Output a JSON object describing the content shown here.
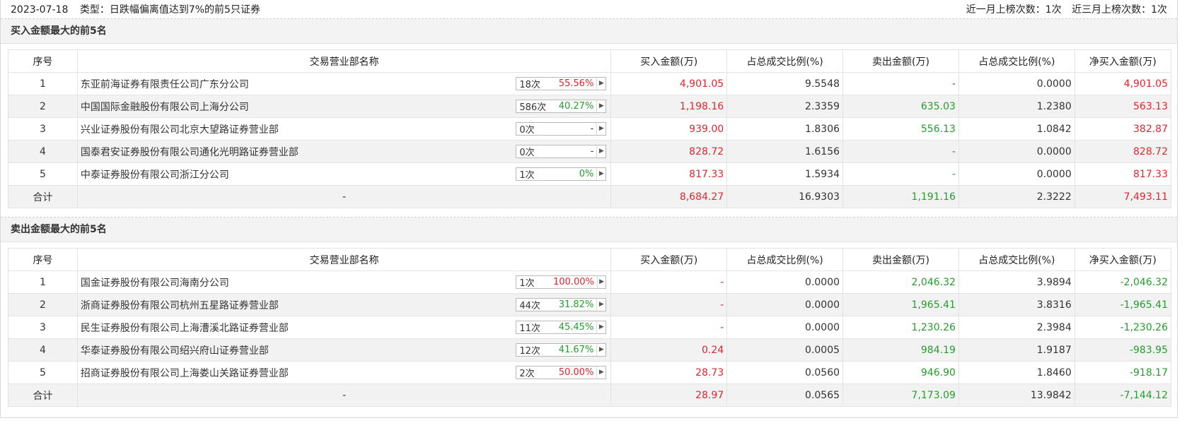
{
  "header": {
    "date": "2023-07-18",
    "type_label": "类型：日跌幅偏离值达到7%的前5只证券",
    "month_count": "近一月上榜次数：1次",
    "three_month_count": "近三月上榜次数：1次"
  },
  "columns": [
    "序号",
    "交易营业部名称",
    "买入金额(万)",
    "占总成交比例(%)",
    "卖出金额(万)",
    "占总成交比例(%)",
    "净买入金额(万)"
  ],
  "buy_section": {
    "title": "买入金额最大的前5名",
    "rows": [
      {
        "idx": "1",
        "name": "东亚前海证券有限责任公司广东分公司",
        "times": "18次",
        "rate": "55.56%",
        "rate_color": "red",
        "buy": "4,901.05",
        "buy_pct": "9.5548",
        "sell": "-",
        "sell_color": "red",
        "sell_pct": "0.0000",
        "net": "4,901.05",
        "net_color": "red"
      },
      {
        "idx": "2",
        "name": "中国国际金融股份有限公司上海分公司",
        "times": "586次",
        "rate": "40.27%",
        "rate_color": "green",
        "buy": "1,198.16",
        "buy_pct": "2.3359",
        "sell": "635.03",
        "sell_color": "green",
        "sell_pct": "1.2380",
        "net": "563.13",
        "net_color": "red"
      },
      {
        "idx": "3",
        "name": "兴业证券股份有限公司北京大望路证券营业部",
        "times": "0次",
        "rate": "-",
        "rate_color": "gray",
        "buy": "939.00",
        "buy_pct": "1.8306",
        "sell": "556.13",
        "sell_color": "green",
        "sell_pct": "1.0842",
        "net": "382.87",
        "net_color": "red"
      },
      {
        "idx": "4",
        "name": "国泰君安证券股份有限公司通化光明路证券营业部",
        "times": "0次",
        "rate": "-",
        "rate_color": "gray",
        "buy": "828.72",
        "buy_pct": "1.6156",
        "sell": "-",
        "sell_color": "green",
        "sell_pct": "0.0000",
        "net": "828.72",
        "net_color": "red"
      },
      {
        "idx": "5",
        "name": "中泰证券股份有限公司浙江分公司",
        "times": "1次",
        "rate": "0%",
        "rate_color": "green",
        "buy": "817.33",
        "buy_pct": "1.5934",
        "sell": "-",
        "sell_color": "green",
        "sell_pct": "0.0000",
        "net": "817.33",
        "net_color": "red"
      }
    ],
    "total": {
      "label": "合计",
      "name": "-",
      "buy": "8,684.27",
      "buy_pct": "16.9303",
      "sell": "1,191.16",
      "sell_pct": "2.3222",
      "net": "7,493.11",
      "net_color": "red"
    }
  },
  "sell_section": {
    "title": "卖出金额最大的前5名",
    "rows": [
      {
        "idx": "1",
        "name": "国金证券股份有限公司海南分公司",
        "times": "1次",
        "rate": "100.00%",
        "rate_color": "red",
        "buy": "-",
        "buy_pct": "0.0000",
        "sell": "2,046.32",
        "sell_color": "green",
        "sell_pct": "3.9894",
        "net": "-2,046.32",
        "net_color": "green"
      },
      {
        "idx": "2",
        "name": "浙商证券股份有限公司杭州五星路证券营业部",
        "times": "44次",
        "rate": "31.82%",
        "rate_color": "green",
        "buy": "-",
        "buy_pct": "0.0000",
        "sell": "1,965.41",
        "sell_color": "green",
        "sell_pct": "3.8316",
        "net": "-1,965.41",
        "net_color": "green"
      },
      {
        "idx": "3",
        "name": "民生证券股份有限公司上海漕溪北路证券营业部",
        "times": "11次",
        "rate": "45.45%",
        "rate_color": "green",
        "buy": "-",
        "buy_pct": "0.0000",
        "sell": "1,230.26",
        "sell_color": "green",
        "sell_pct": "2.3984",
        "net": "-1,230.26",
        "net_color": "green"
      },
      {
        "idx": "4",
        "name": "华泰证券股份有限公司绍兴府山证券营业部",
        "times": "12次",
        "rate": "41.67%",
        "rate_color": "green",
        "buy": "0.24",
        "buy_pct": "0.0005",
        "sell": "984.19",
        "sell_color": "green",
        "sell_pct": "1.9187",
        "net": "-983.95",
        "net_color": "green"
      },
      {
        "idx": "5",
        "name": "招商证券股份有限公司上海娄山关路证券营业部",
        "times": "2次",
        "rate": "50.00%",
        "rate_color": "red",
        "buy": "28.73",
        "buy_pct": "0.0560",
        "sell": "946.90",
        "sell_color": "green",
        "sell_pct": "1.8460",
        "net": "-918.17",
        "net_color": "green"
      }
    ],
    "total": {
      "label": "合计",
      "name": "-",
      "buy": "28.97",
      "buy_pct": "0.0565",
      "sell": "7,173.09",
      "sell_pct": "13.9842",
      "net": "-7,144.12",
      "net_color": "green"
    }
  },
  "colors": {
    "red": "#e3262e",
    "green": "#249d2d"
  }
}
